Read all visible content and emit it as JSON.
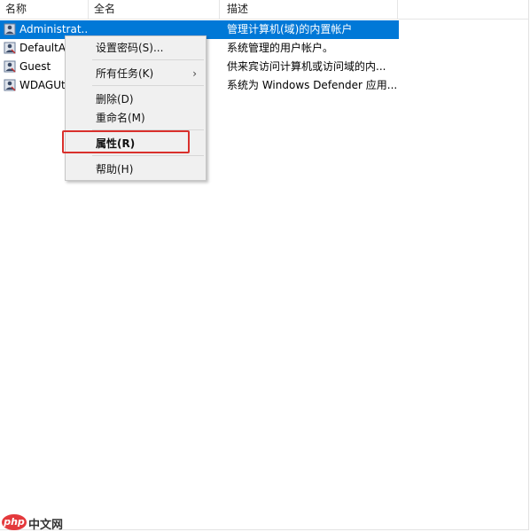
{
  "columns": [
    "名称",
    "全名",
    "描述"
  ],
  "rows": [
    {
      "name": "Administrat...",
      "fullname": "",
      "desc": "管理计算机(域)的内置帐户",
      "selected": true
    },
    {
      "name": "DefaultAc",
      "fullname": "",
      "desc": "系统管理的用户帐户。",
      "selected": false
    },
    {
      "name": "Guest",
      "fullname": "",
      "desc": "供来宾访问计算机或访问域的内...",
      "selected": false
    },
    {
      "name": "WDAGUt",
      "fullname": "",
      "desc": "系统为 Windows Defender 应用...",
      "selected": false
    }
  ],
  "menu": {
    "set_password": "设置密码(S)...",
    "all_tasks": "所有任务(K)",
    "delete": "删除(D)",
    "rename": "重命名(M)",
    "properties": "属性(R)",
    "help": "帮助(H)"
  },
  "colors": {
    "selection": "#0078d7",
    "highlight_box": "#d9302c"
  },
  "watermark": {
    "badge": "php",
    "text": "中文网"
  }
}
